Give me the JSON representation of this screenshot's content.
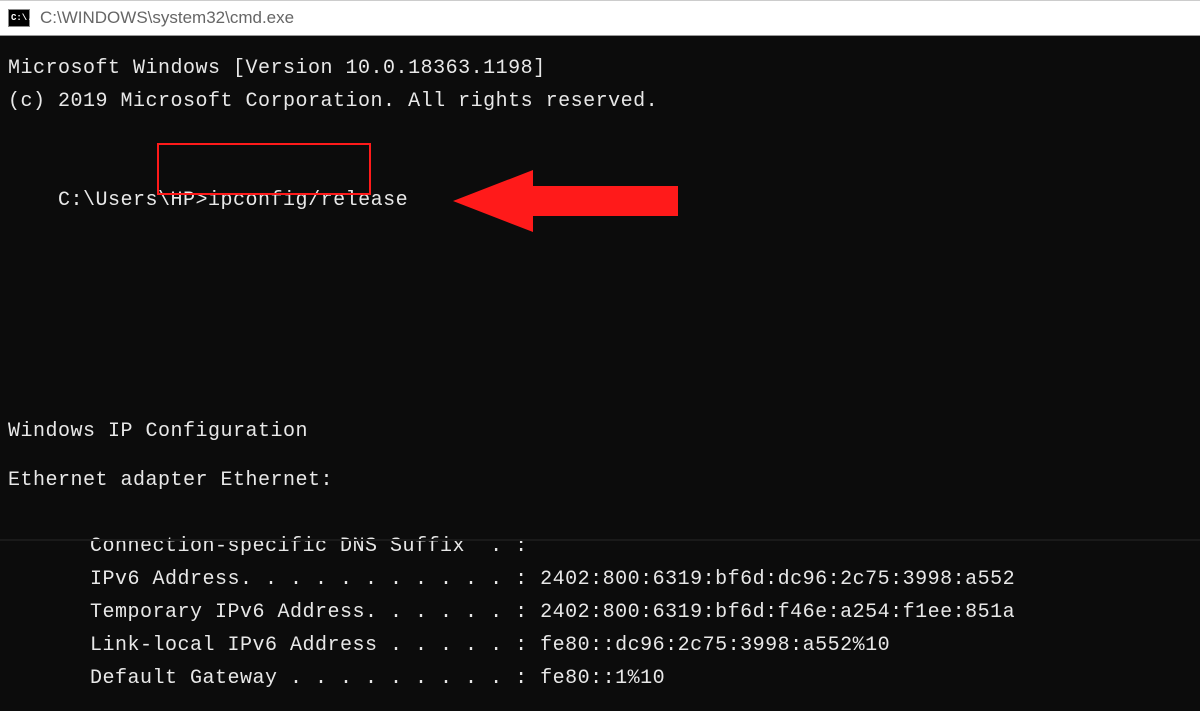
{
  "window": {
    "title": "C:\\WINDOWS\\system32\\cmd.exe",
    "icon_label": "C:\\."
  },
  "terminal": {
    "header_line1": "Microsoft Windows [Version 10.0.18363.1198]",
    "header_line2": "(c) 2019 Microsoft Corporation. All rights reserved.",
    "prompt_path": "C:\\Users\\HP>",
    "command": "ipconfig/release",
    "section_title": "Windows IP Configuration",
    "adapter_title": "Ethernet adapter Ethernet:",
    "fields": [
      {
        "label": "Connection-specific DNS Suffix  . :",
        "value": ""
      },
      {
        "label": "IPv6 Address. . . . . . . . . . . :",
        "value": " 2402:800:6319:bf6d:dc96:2c75:3998:a552"
      },
      {
        "label": "Temporary IPv6 Address. . . . . . :",
        "value": " 2402:800:6319:bf6d:f46e:a254:f1ee:851a"
      },
      {
        "label": "Link-local IPv6 Address . . . . . :",
        "value": " fe80::dc96:2c75:3998:a552%10"
      },
      {
        "label": "Default Gateway . . . . . . . . . :",
        "value": " fe80::1%10"
      }
    ]
  },
  "annotation": {
    "highlight_color": "#ff1a1a",
    "arrow_color": "#ff1a1a"
  }
}
